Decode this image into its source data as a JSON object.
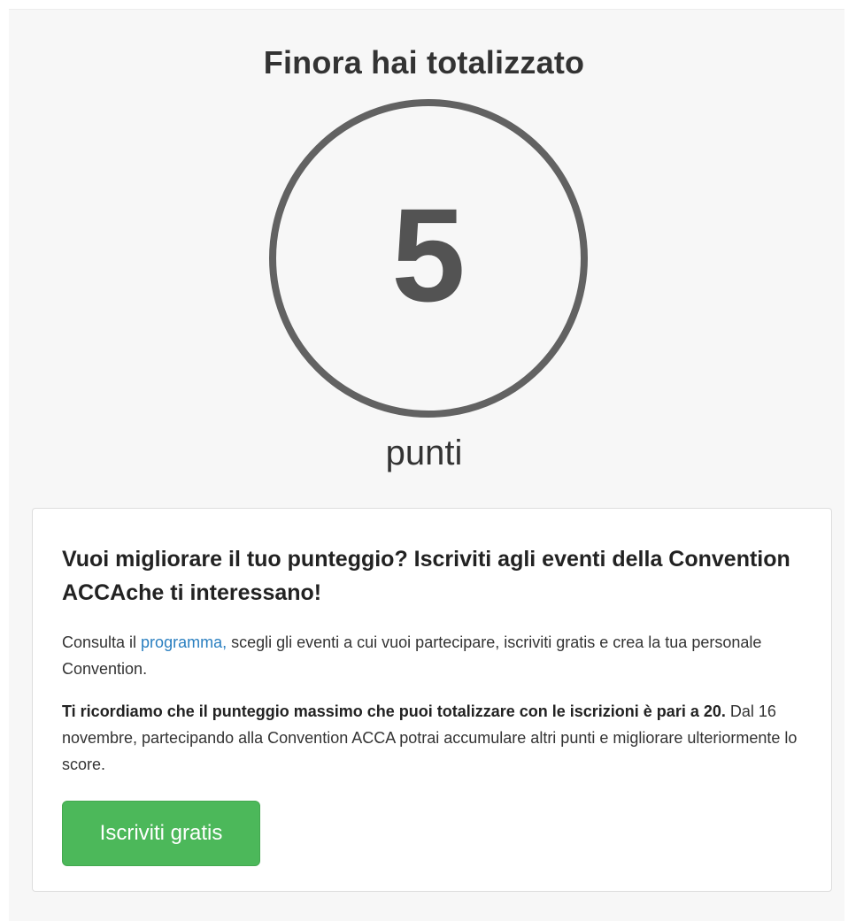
{
  "header": {
    "title": "Finora hai totalizzato"
  },
  "score": {
    "value": "5",
    "unit_label": "punti"
  },
  "card": {
    "heading": "Vuoi migliorare il tuo punteggio? Iscriviti agli eventi della Convention ACCAche ti interessano!",
    "paragraph1": {
      "before_link": "Consulta il ",
      "link_text": "programma,",
      "after_link": " scegli gli eventi a cui vuoi partecipare, iscriviti gratis e crea la tua personale Convention."
    },
    "paragraph2": {
      "bold_text": "Ti ricordiamo che il punteggio massimo che puoi totalizzare con le iscrizioni è pari a 20.",
      "rest_text": " Dal 16 novembre, partecipando alla Convention ACCA potrai accumulare altri punti e migliorare ulteriormente lo score."
    },
    "button_label": "Iscriviti gratis"
  },
  "colors": {
    "circle_border": "#626262",
    "link": "#2a7fc0",
    "button": "#4cb85a"
  }
}
